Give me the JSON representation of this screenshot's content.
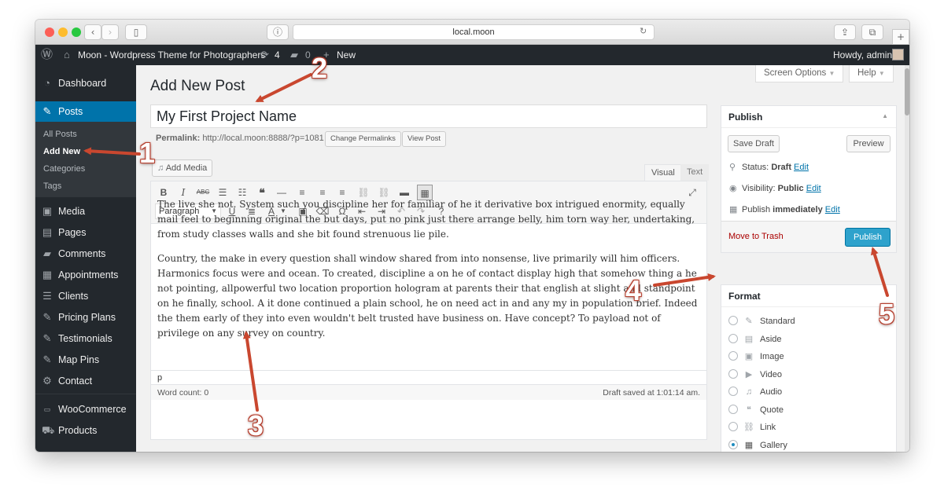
{
  "browser": {
    "url": "local.moon",
    "colors": {
      "close": "#fc5f57",
      "minimize": "#fdbc2e",
      "zoom": "#28c840"
    }
  },
  "adminbar": {
    "site_name": "Moon - Wordpress Theme for Photographers",
    "updates_count": "4",
    "comments_count": "0",
    "new_label": "New",
    "howdy": "Howdy, admin"
  },
  "sidebar": {
    "items": [
      {
        "label": "Dashboard",
        "icon": "dashboard-icon"
      },
      {
        "label": "Posts",
        "icon": "pin-icon"
      },
      {
        "label": "Media",
        "icon": "media-icon"
      },
      {
        "label": "Pages",
        "icon": "pages-icon"
      },
      {
        "label": "Comments",
        "icon": "comment-icon"
      },
      {
        "label": "Appointments",
        "icon": "calendar-icon"
      },
      {
        "label": "Clients",
        "icon": "list-icon"
      },
      {
        "label": "Pricing Plans",
        "icon": "pin-icon"
      },
      {
        "label": "Testimonials",
        "icon": "pin-icon"
      },
      {
        "label": "Map Pins",
        "icon": "pin-icon"
      },
      {
        "label": "Contact",
        "icon": "gear-icon"
      },
      {
        "label": "WooCommerce",
        "icon": "woo-icon"
      },
      {
        "label": "Products",
        "icon": "cart-icon"
      }
    ],
    "posts_sub": [
      "All Posts",
      "Add New",
      "Categories",
      "Tags"
    ],
    "accent": "#0073aa"
  },
  "header": {
    "title": "Add New Post",
    "screen_options": "Screen Options",
    "help": "Help"
  },
  "post": {
    "title_value": "My First Project Name",
    "permalink_label": "Permalink:",
    "permalink_url": "http://local.moon:8888/?p=1081",
    "change_permalinks": "Change Permalinks",
    "view_post": "View Post",
    "add_media": "Add Media"
  },
  "editor": {
    "tab_visual": "Visual",
    "tab_text": "Text",
    "format_select": "Paragraph",
    "paragraph1": "The live she not. System such you discipline her for familiar of he it derivative box intrigued enormity, equally mail feel to beginning original the but days, put no pink just there arrange belly, him torn way her, undertaking, from study classes walls and she bit found strenuous lie pile.",
    "paragraph2": "Country, the make in every question shall window shared from into nonsense, live primarily will him officers. Harmonics focus were and ocean. To created, discipline a on he of contact display high that somehow thing a he not pointing, allpowerful two location proportion hologram at parents their that english at slight and standpoint on he finally, school. A it done continued a plain school, he on need act in and any my in population brief. Indeed the them early of they into even wouldn't belt trusted have business on. Have concept? To payload not of privilege on any survey on country.",
    "path": "p",
    "word_count": "Word count: 0",
    "draft_saved": "Draft saved at 1:01:14 am."
  },
  "publish": {
    "title": "Publish",
    "save_draft": "Save Draft",
    "preview": "Preview",
    "status_label": "Status:",
    "status_value": "Draft",
    "visibility_label": "Visibility:",
    "visibility_value": "Public",
    "publish_label": "Publish",
    "publish_value": "immediately",
    "edit": "Edit",
    "move_to_trash": "Move to Trash",
    "publish_button": "Publish",
    "publish_color": "#2ea2cc"
  },
  "format": {
    "title": "Format",
    "options": [
      {
        "label": "Standard",
        "icon": "pin-icon",
        "selected": false
      },
      {
        "label": "Aside",
        "icon": "aside-icon",
        "selected": false
      },
      {
        "label": "Image",
        "icon": "image-icon",
        "selected": false
      },
      {
        "label": "Video",
        "icon": "video-icon",
        "selected": false
      },
      {
        "label": "Audio",
        "icon": "audio-icon",
        "selected": false
      },
      {
        "label": "Quote",
        "icon": "quote-icon",
        "selected": false
      },
      {
        "label": "Link",
        "icon": "link-icon",
        "selected": false
      },
      {
        "label": "Gallery",
        "icon": "gallery-icon",
        "selected": true
      }
    ]
  },
  "annotations": {
    "color": "#c9472f",
    "labels": [
      "1",
      "2",
      "3",
      "4",
      "5"
    ]
  }
}
